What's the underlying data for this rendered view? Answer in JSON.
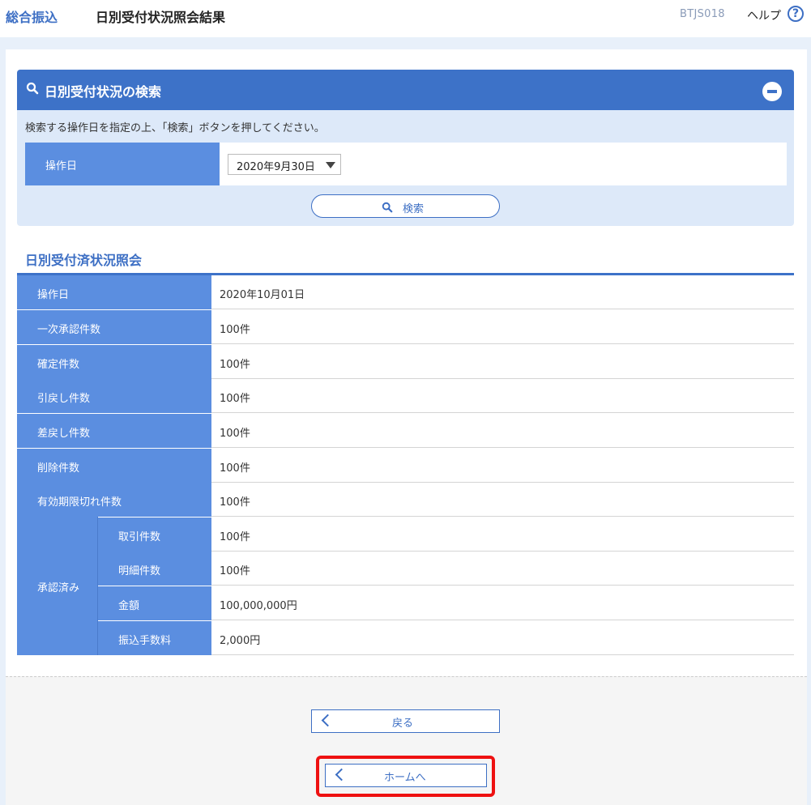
{
  "header": {
    "app_title": "総合振込",
    "page_title": "日別受付状況照会結果",
    "screen_id": "BTJS018",
    "help_label": "ヘルプ",
    "help_icon": "?"
  },
  "search": {
    "title": "日別受付状況の検索",
    "description": "検索する操作日を指定の上、「検索」ボタンを押してください。",
    "date_label": "操作日",
    "date_value": "2020年9月30日",
    "search_button": "検索"
  },
  "results": {
    "title": "日別受付済状況照会",
    "rows": [
      {
        "label": "操作日",
        "value": "2020年10月01日"
      },
      {
        "label": "一次承認件数",
        "value": "100件"
      },
      {
        "label": "確定件数",
        "value": "100件"
      },
      {
        "label": "引戻し件数",
        "value": "100件"
      },
      {
        "label": "差戻し件数",
        "value": "100件"
      },
      {
        "label": "削除件数",
        "value": "100件"
      },
      {
        "label": "有効期限切れ件数",
        "value": "100件"
      }
    ],
    "approved_group": {
      "label": "承認済み",
      "rows": [
        {
          "label": "取引件数",
          "value": "100件"
        },
        {
          "label": "明細件数",
          "value": "100件"
        },
        {
          "label": "金額",
          "value": "100,000,000円"
        },
        {
          "label": "振込手数料",
          "value": "2,000円"
        }
      ]
    }
  },
  "actions": {
    "back_label": "戻る",
    "home_label": "ホームへ"
  },
  "colors": {
    "accent": "#3d72c8",
    "header_cell": "#5b8ee0",
    "highlight": "#ee1111"
  }
}
